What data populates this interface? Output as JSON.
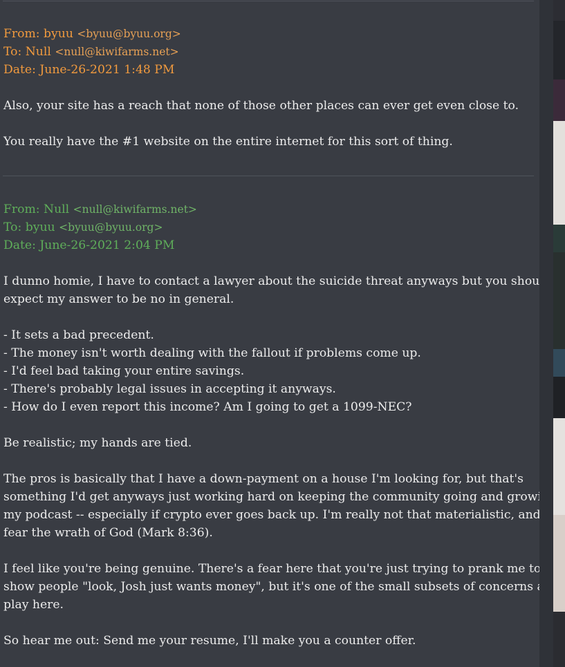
{
  "email1": {
    "from_label": "From:",
    "from_name": "byuu",
    "from_addr": "<byuu@byuu.org>",
    "to_label": "To:",
    "to_name": "Null",
    "to_addr": "<null@kiwifarms.net>",
    "date": "Date: June-26-2021 1:48 PM",
    "body": [
      "Also, your site has a reach that none of those other places can ever get even close to.",
      "You really have the #1 website on the entire internet for this sort of thing."
    ]
  },
  "email2": {
    "from_label": "From:",
    "from_name": "Null",
    "from_addr": "<null@kiwifarms.net>",
    "to_label": "To:",
    "to_name": "byuu",
    "to_addr": "<byuu@byuu.org>",
    "date": "Date: June-26-2021 2:04 PM",
    "intro_lines": [
      "I dunno homie, I have to contact a lawyer about the suicide threat anyways but you should",
      "expect my answer to be no in general."
    ],
    "bullets": [
      "- It sets a bad precedent.",
      "- The money isn't worth dealing with the fallout if problems come up.",
      "- I'd feel bad taking your entire savings.",
      "- There's probably legal issues in accepting it anyways.",
      "- How do I even report this income? Am I going to get a 1099-NEC?"
    ],
    "realistic": "Be realistic; my hands are tied.",
    "pros_lines": [
      "The pros is basically that I have a down-payment on a house I'm looking for, but that's",
      "something I'd get anyways just working hard on keeping the community going and growing",
      "my podcast -- especially if crypto ever goes back up. I'm really not that materialistic, and I",
      "fear the wrath of God (Mark 8:36)."
    ],
    "genuine_lines": [
      "I feel like you're being genuine. There's a fear here that you're just trying to prank me to",
      "show people \"look, Josh just wants money\", but it's one of the small subsets of concerns at",
      "play here."
    ],
    "closing": "So hear me out: Send me your resume, I'll make you a counter offer."
  },
  "colors": {
    "background": "#393c43",
    "text": "#ececec",
    "header_orange": "#f19a3e",
    "header_green": "#5fae5a"
  }
}
